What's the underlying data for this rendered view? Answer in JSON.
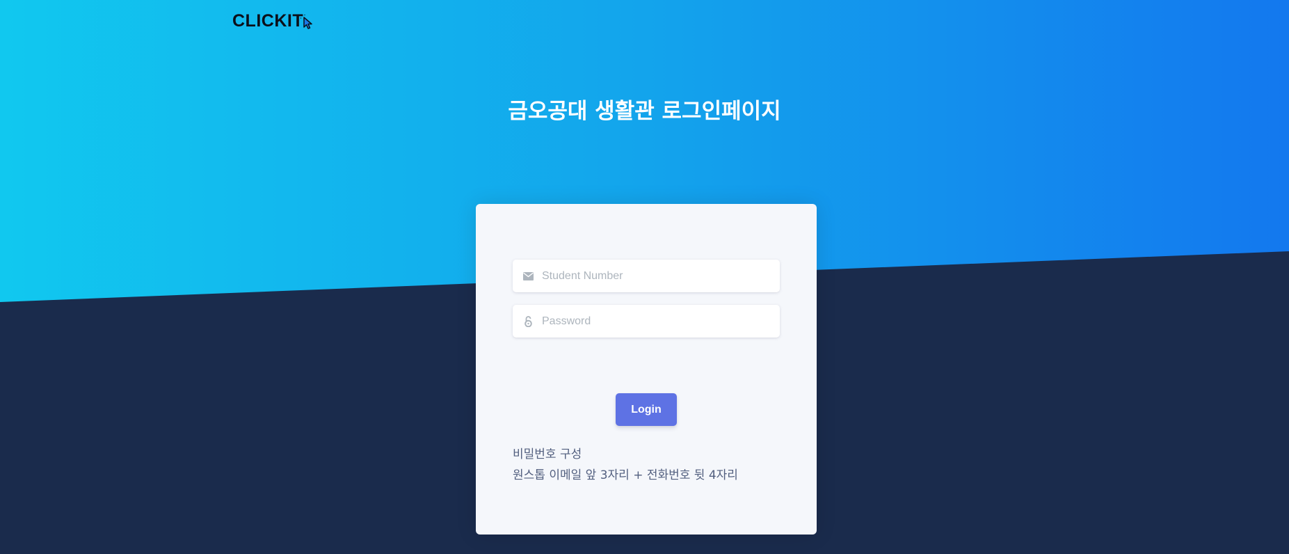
{
  "logo": {
    "text": "CLICKIT"
  },
  "page": {
    "title": "금오공대 생활관 로그인페이지"
  },
  "login_form": {
    "student_number_placeholder": "Student Number",
    "password_placeholder": "Password",
    "login_button": "Login",
    "hint_title": "비밀번호 구성",
    "hint_body": "원스톱 이메일 앞 3자리 + 전화번호 뒷 4자리"
  },
  "colors": {
    "gradient_start": "#11c8ef",
    "gradient_end": "#1378ee",
    "background_dark": "#1a2b4c",
    "card": "#f5f7fb",
    "button": "#5e72e4"
  },
  "icons": {
    "student_field": "envelope-icon",
    "password_field": "lock-open-icon",
    "logo": "mouse-pointer-icon"
  }
}
